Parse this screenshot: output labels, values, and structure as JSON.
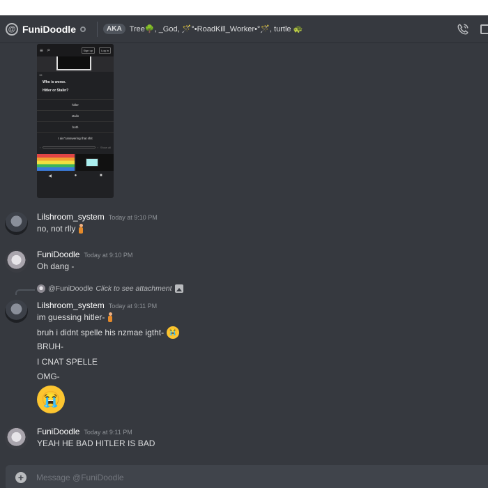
{
  "header": {
    "channel_name": "FuniDoodle",
    "aka_badge": "AKA",
    "aka_names": "Tree🌳, _God, 🪄°•RoadKill_Worker•°🪄, turtle 🐢"
  },
  "attachment": {
    "signup": "Sign up",
    "login": "Log in",
    "number": "15",
    "question_line1": "Who is worse.",
    "question_line2": "Hitler or Stalin?",
    "options": [
      "hitler",
      "stalin",
      "both",
      "I ain't answering that shit"
    ],
    "show_all": "Show all"
  },
  "messages": [
    {
      "author": "Lilshroom_system",
      "time": "Today at 9:10 PM",
      "lines": [
        "no, not rlly"
      ]
    },
    {
      "author": "FuniDoodle",
      "time": "Today at 9:10 PM",
      "lines": [
        "Oh dang -"
      ]
    },
    {
      "author": "Lilshroom_system",
      "time": "Today at 9:11 PM",
      "reply": {
        "mention": "@FuniDoodle",
        "text": "Click to see attachment"
      },
      "lines": [
        "im guessing hitler-",
        "bruh i didnt spelle his nzmae igtht-",
        "BRUH-",
        "I CNAT SPELLE",
        "OMG-"
      ]
    },
    {
      "author": "FuniDoodle",
      "time": "Today at 9:11 PM",
      "lines": [
        "YEAH HE BAD HITLER IS BAD"
      ]
    }
  ],
  "composer": {
    "placeholder": "Message @FuniDoodle"
  }
}
